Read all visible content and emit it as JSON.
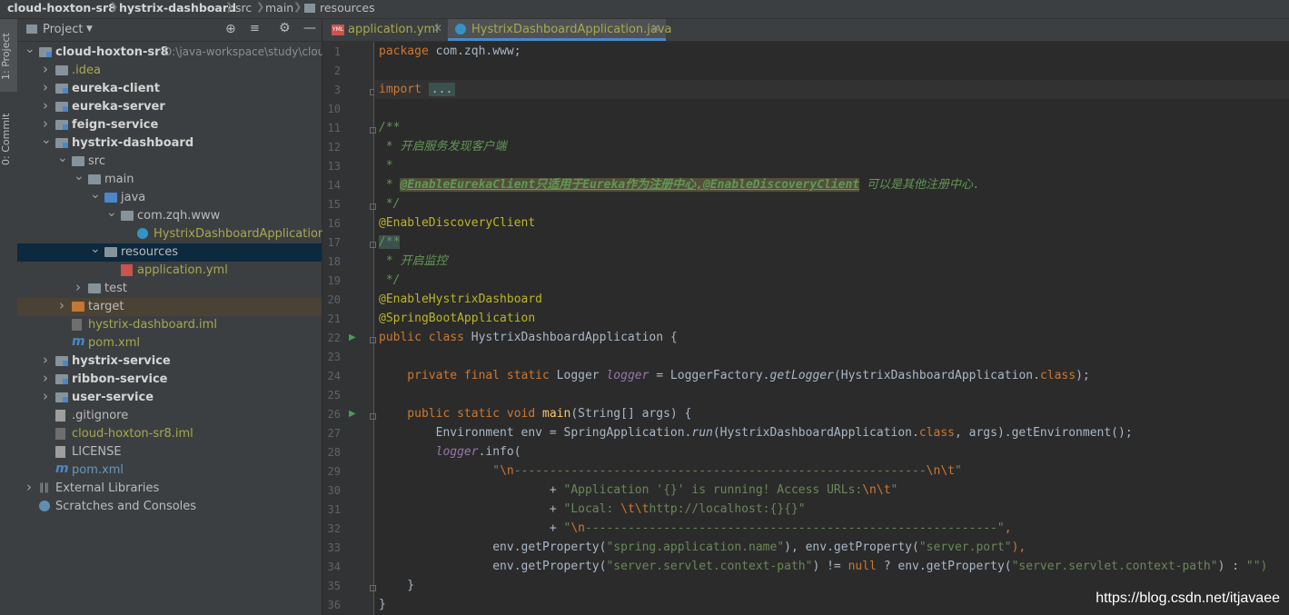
{
  "breadcrumb": {
    "project": "cloud-hoxton-sr8",
    "module": "hystrix-dashboard",
    "src": "src",
    "main": "main",
    "resources": "resources"
  },
  "left_toolwindow": {
    "project_label": "1: Project",
    "commit_label": "0: Commit"
  },
  "project_panel": {
    "title": "Project",
    "root_path": "D:\\java-workspace\\study\\cloud",
    "tree": [
      {
        "label": "cloud-hoxton-sr8",
        "level": 0,
        "expanded": true,
        "kind": "module",
        "bold": true
      },
      {
        "label": ".idea",
        "level": 1,
        "expanded": false,
        "kind": "folder",
        "color": "#a8a84f"
      },
      {
        "label": "eureka-client",
        "level": 1,
        "expanded": false,
        "kind": "module",
        "bold": true
      },
      {
        "label": "eureka-server",
        "level": 1,
        "expanded": false,
        "kind": "module",
        "bold": true
      },
      {
        "label": "feign-service",
        "level": 1,
        "expanded": false,
        "kind": "module",
        "bold": true
      },
      {
        "label": "hystrix-dashboard",
        "level": 1,
        "expanded": true,
        "kind": "module",
        "bold": true
      },
      {
        "label": "src",
        "level": 2,
        "expanded": true,
        "kind": "folder"
      },
      {
        "label": "main",
        "level": 3,
        "expanded": true,
        "kind": "folder"
      },
      {
        "label": "java",
        "level": 4,
        "expanded": true,
        "kind": "folder-blue"
      },
      {
        "label": "com.zqh.www",
        "level": 5,
        "expanded": true,
        "kind": "package"
      },
      {
        "label": "HystrixDashboardApplication",
        "level": 6,
        "kind": "class",
        "color": "#a8a84f"
      },
      {
        "label": "resources",
        "level": 4,
        "expanded": true,
        "kind": "resources",
        "selected": true
      },
      {
        "label": "application.yml",
        "level": 5,
        "kind": "yml",
        "color": "#a8a84f"
      },
      {
        "label": "test",
        "level": 3,
        "expanded": false,
        "kind": "folder"
      },
      {
        "label": "target",
        "level": 2,
        "expanded": false,
        "kind": "folder-orange",
        "ignored": true
      },
      {
        "label": "hystrix-dashboard.iml",
        "level": 2,
        "kind": "iml",
        "color": "#a8a84f"
      },
      {
        "label": "pom.xml",
        "level": 2,
        "kind": "maven",
        "color": "#a8a84f"
      },
      {
        "label": "hystrix-service",
        "level": 1,
        "expanded": false,
        "kind": "module",
        "bold": true
      },
      {
        "label": "ribbon-service",
        "level": 1,
        "expanded": false,
        "kind": "module",
        "bold": true
      },
      {
        "label": "user-service",
        "level": 1,
        "expanded": false,
        "kind": "module",
        "bold": true
      },
      {
        "label": ".gitignore",
        "level": 1,
        "kind": "file"
      },
      {
        "label": "cloud-hoxton-sr8.iml",
        "level": 1,
        "kind": "iml",
        "color": "#a8a84f"
      },
      {
        "label": "LICENSE",
        "level": 1,
        "kind": "file"
      },
      {
        "label": "pom.xml",
        "level": 1,
        "kind": "maven",
        "color": "#6897bb"
      },
      {
        "label": "External Libraries",
        "level": 0,
        "expanded": false,
        "kind": "libraries"
      },
      {
        "label": "Scratches and Consoles",
        "level": 0,
        "kind": "scratches"
      }
    ]
  },
  "editor_tabs": [
    {
      "label": "application.yml",
      "active": false,
      "icon": "yml-file-icon"
    },
    {
      "label": "HystrixDashboardApplication.java",
      "active": true,
      "icon": "java-class-icon"
    }
  ],
  "line_numbers": [
    "1",
    "2",
    "3",
    "10",
    "11",
    "12",
    "13",
    "14",
    "15",
    "16",
    "17",
    "18",
    "19",
    "20",
    "21",
    "22",
    "23",
    "24",
    "25",
    "26",
    "27",
    "28",
    "29",
    "30",
    "31",
    "32",
    "33",
    "34",
    "35",
    "36"
  ],
  "code": {
    "l1_kw": "package",
    "l1_rest": " com.zqh.www;",
    "l3_kw": "import",
    "l3_fold": "...",
    "l11": "/**",
    "l12": " * 开启服务发现客户端",
    "l13": " *",
    "l14_pre": " * ",
    "l14_tag": "@EnableEurekaClient只适用于Eureka作为注册中心,@EnableDiscoveryClient",
    "l14_post": " 可以是其他注册中心.",
    "l15": " */",
    "l16": "@EnableDiscoveryClient",
    "l17": "/**",
    "l18": " * 开启监控",
    "l19": " */",
    "l20": "@EnableHystrixDashboard",
    "l21": "@SpringBootApplication",
    "l22_kw": "public class",
    "l22_rest": " HystrixDashboardApplication {",
    "l24_kw": "    private final static",
    "l24_type": " Logger ",
    "l24_field": "logger",
    "l24_eq": " = LoggerFactory.",
    "l24_m": "getLogger",
    "l24_arg": "(HystrixDashboardApplication.",
    "l24_cls": "class",
    "l24_end": ");",
    "l26_kw": "    public static void",
    "l26_fn": " main",
    "l26_rest": "(String[] args) {",
    "l27_a": "        Environment env = SpringApplication.",
    "l27_m": "run",
    "l27_b": "(HystrixDashboardApplication.",
    "l27_cls": "class",
    "l27_c": ", args).getEnvironment();",
    "l28_field": "        logger",
    "l28_rest": ".info(",
    "l29_q": "                \"",
    "l29_esc": "\\n",
    "l29_str": "----------------------------------------------------------",
    "l29_end": "\\n\\t",
    "l29_close": "\"",
    "l30_plus": "                        + ",
    "l30_str": "\"Application '{}' is running! Access URLs:",
    "l30_esc": "\\n\\t",
    "l30_close": "\"",
    "l31_plus": "                        + ",
    "l31_str": "\"Local: ",
    "l31_esc": "\\t\\t",
    "l31_str2": "http://localhost:{}{}\"",
    "l32_plus": "                        + ",
    "l32_q": "\"",
    "l32_esc": "\\n",
    "l32_str": "----------------------------------------------------------\"",
    "l32_comma": ",",
    "l33_a": "                env.getProperty(",
    "l33_s1": "\"spring.application.name\"",
    "l33_b": "), env.getProperty(",
    "l33_s2": "\"server.port\"",
    "l33_c": "),",
    "l34_a": "                env.getProperty(",
    "l34_s1": "\"server.servlet.context-path\"",
    "l34_b": ") != ",
    "l34_null": "null",
    "l34_c": " ? env.getProperty(",
    "l34_s2": "\"server.servlet.context-path\"",
    "l34_d": ") : ",
    "l34_s3": "\"\")",
    "l35": "    }",
    "l36": "}"
  },
  "watermark": "https://blog.csdn.net/itjavaee"
}
